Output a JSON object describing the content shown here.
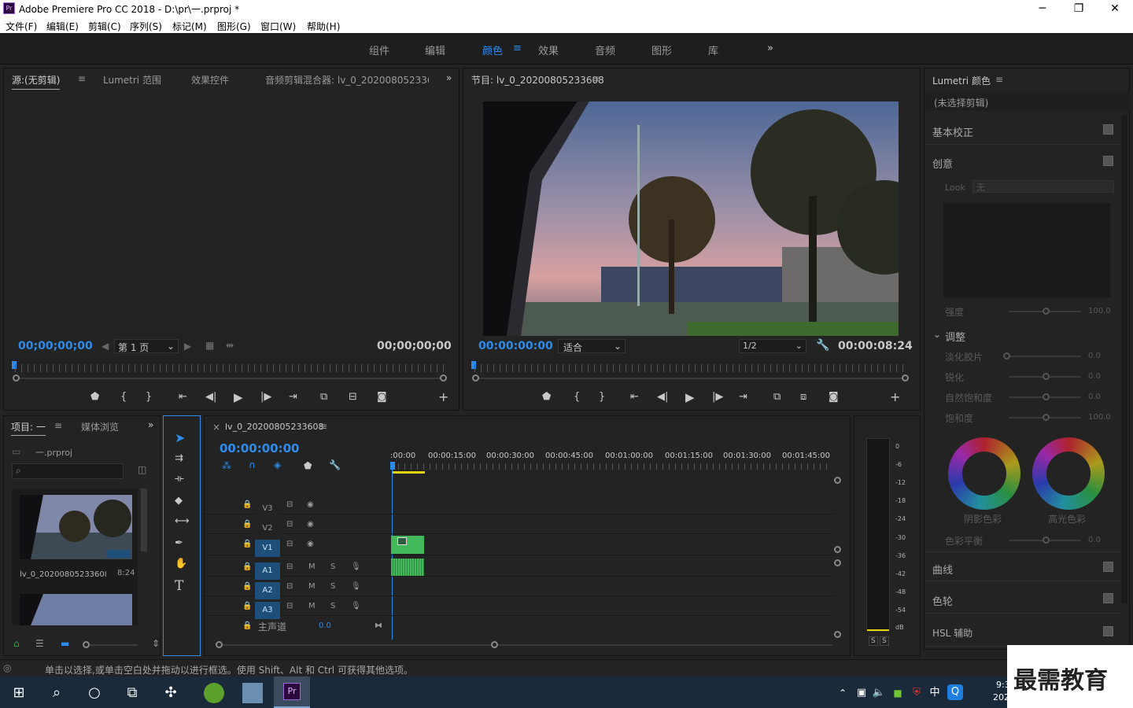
{
  "window": {
    "title": "Adobe Premiere Pro CC 2018 - D:\\pr\\一.prproj *",
    "logo": "Pr"
  },
  "menu": [
    "文件(F)",
    "编辑(E)",
    "剪辑(C)",
    "序列(S)",
    "标记(M)",
    "图形(G)",
    "窗口(W)",
    "帮助(H)"
  ],
  "workspaces": {
    "items": [
      "组件",
      "编辑",
      "颜色",
      "效果",
      "音频",
      "图形",
      "库"
    ],
    "active": "颜色",
    "more": "»"
  },
  "source": {
    "tabs": [
      "源:(无剪辑)",
      "Lumetri 范围",
      "效果控件",
      "音频剪辑混合器: lv_0_2020080523360"
    ],
    "timecode_in": "00;00;00;00",
    "page": "第 1 页",
    "timecode_out": "00;00;00;00"
  },
  "program": {
    "title": "节目: lv_0_20200805233608",
    "timecode": "00:00:00:00",
    "fit": "适合",
    "resolution": "1/2",
    "duration": "00:00:08:24"
  },
  "project": {
    "tab1": "项目: 一",
    "tab2": "媒体浏览",
    "file": "一.prproj",
    "search_placeholder": "",
    "clip_name": "lv_0_20200805233608..",
    "clip_duration": "8:24"
  },
  "timeline": {
    "tab": "lv_0_20200805233608",
    "timecode": "00:00:00:00",
    "ruler": [
      ":00:00",
      "00:00:15:00",
      "00:00:30:00",
      "00:00:45:00",
      "00:01:00:00",
      "00:01:15:00",
      "00:01:30:00",
      "00:01:45:00"
    ],
    "video_tracks": [
      "V3",
      "V2",
      "V1"
    ],
    "audio_tracks": [
      "A1",
      "A2",
      "A3"
    ],
    "master": "主声道",
    "master_val": "0.0",
    "m": "M",
    "s": "S"
  },
  "meter": {
    "scale": [
      "0",
      "-6",
      "-12",
      "-18",
      "-24",
      "-30",
      "-36",
      "-42",
      "-48",
      "-54",
      "dB"
    ],
    "solo": [
      "S",
      "S"
    ]
  },
  "lumetri": {
    "title": "Lumetri 颜色",
    "clip": "(未选择剪辑)",
    "basic": "基本校正",
    "creative": "创意",
    "look_label": "Look",
    "look_val": "无",
    "intensity": "强度",
    "intensity_val": "100.0",
    "adjust": "调整",
    "faded": "淡化胶片",
    "faded_val": "0.0",
    "sharpen": "锐化",
    "sharpen_val": "0.0",
    "vibrance": "自然饱和度",
    "vibrance_val": "0.0",
    "saturation": "饱和度",
    "saturation_val": "100.0",
    "shadow": "阴影色彩",
    "highlight": "高光色彩",
    "balance": "色彩平衡",
    "balance_val": "0.0",
    "curves": "曲线",
    "wheels": "色轮",
    "hsl": "HSL 辅助"
  },
  "status": "单击以选择,或单击空白处并拖动以进行框选。使用 Shift、Alt 和 Ctrl 可获得其他选项。",
  "tray": {
    "ime": "中",
    "time": "9:3",
    "date": "202"
  },
  "watermark": "最需教育",
  "colors": {
    "accent": "#2d8ceb",
    "clip_green": "#43b85a",
    "track_blue": "#1d4f7a",
    "playhead": "#2d8ceb"
  }
}
